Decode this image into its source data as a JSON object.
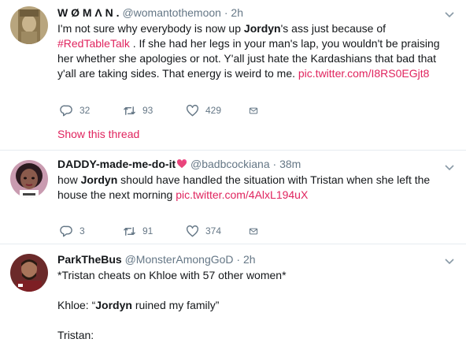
{
  "tweets": [
    {
      "name": "W Ø M Λ N .",
      "handle": "@womantothemoon",
      "time": "2h",
      "text": {
        "p1": "I'm not sure why everybody is now up ",
        "hl": "Jordyn",
        "p2": "'s ass just because of ",
        "hashtag": "#RedTableTalk",
        "p3": " . If she had her legs in your man's lap, you wouldn't be praising her whether she apologies or not. Y'all just hate the Kardashians that bad that y'all are taking sides. That energy is weird to me. ",
        "link": "pic.twitter.com/I8RS0EGjt8"
      },
      "replies": "32",
      "retweets": "93",
      "likes": "429",
      "show_thread": "Show this thread"
    },
    {
      "name": "DADDY-made-me-do-it",
      "handle": "@badbcockiana",
      "time": "38m",
      "text": {
        "p1": "how ",
        "hl": "Jordyn",
        "p2": " should have handled the situation with Tristan when she left the house the next morning ",
        "link": "pic.twitter.com/4AlxL194uX"
      },
      "replies": "3",
      "retweets": "91",
      "likes": "374"
    },
    {
      "name": "ParkTheBus",
      "handle": "@MonsterAmongGoD",
      "time": "2h",
      "line1": "*Tristan cheats on Khloe with 57 other women*",
      "line2a": "Khloe: “",
      "line2hl": "Jordyn",
      "line2b": " ruined my family”",
      "line3": "Tristan:"
    }
  ],
  "separator": " · ",
  "colors": {
    "accent": "#e0245e",
    "muted": "#657786",
    "text": "#14171a",
    "divider": "#e6ecf0"
  },
  "icons": [
    "reply-icon",
    "retweet-icon",
    "like-icon",
    "message-icon",
    "chevron-down-icon",
    "heart-emoji-icon"
  ]
}
